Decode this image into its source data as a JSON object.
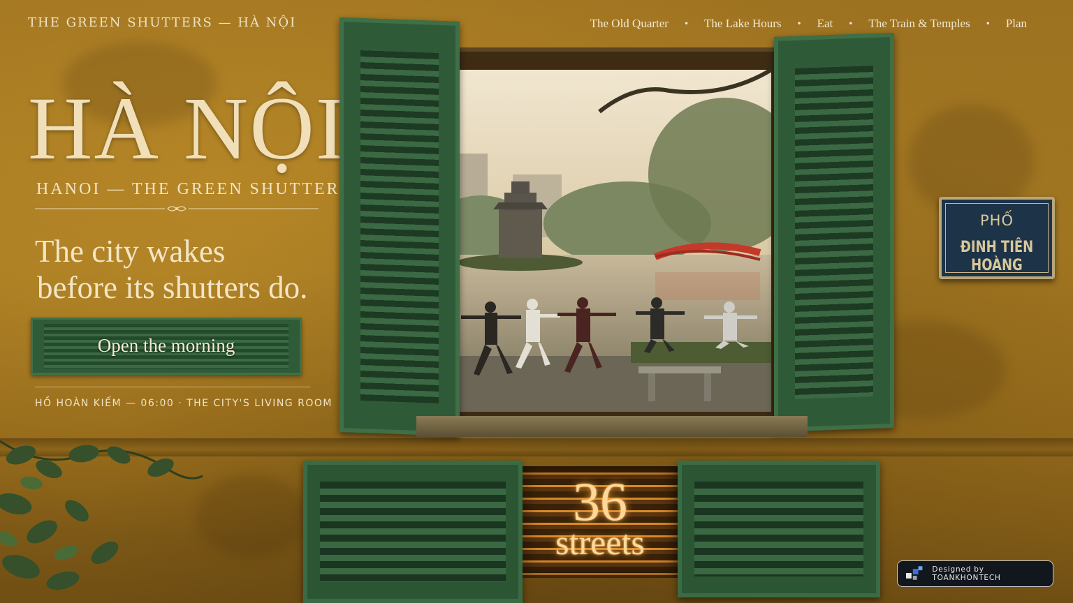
{
  "brand": "THE GREEN SHUTTERS — HÀ NỘI",
  "nav": {
    "items": [
      "The Old Quarter",
      "The Lake Hours",
      "Eat",
      "The Train & Temples",
      "Plan"
    ]
  },
  "hero": {
    "title": "HÀ NỘI",
    "subtitle": "HANOI — THE GREEN SHUTTERS",
    "tagline_line1": "The city wakes",
    "tagline_line2": "before its shutters do.",
    "cta_label": "Open the morning",
    "caption": "HỒ HOÀN KIẾM — 06:00 · THE CITY'S LIVING ROOM"
  },
  "street_sign": {
    "line1": "PHỐ",
    "line2": "ĐINH TIÊN HOÀNG"
  },
  "counter": {
    "number": "36",
    "label": "streets"
  },
  "credit": {
    "text": "Designed by TOANKHONTECH"
  },
  "colors": {
    "wall": "#a57a24",
    "shutter_green": "#2f5a37",
    "cream_text": "#f3e6c6",
    "sign_blue": "#1d3347",
    "glow": "#ffd89a"
  }
}
